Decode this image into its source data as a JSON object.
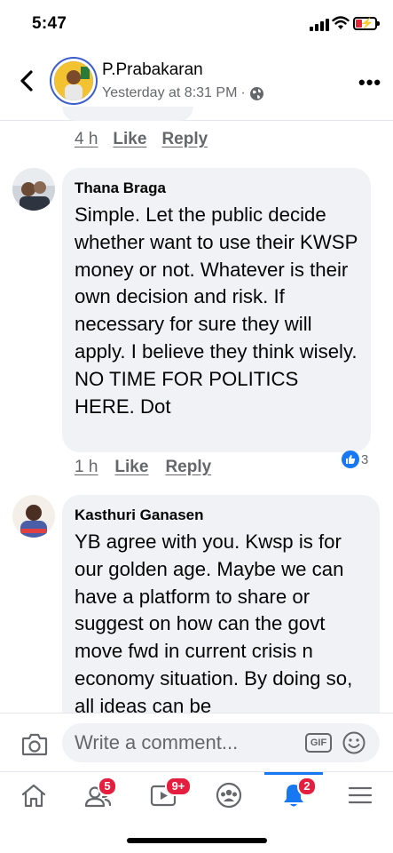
{
  "status_bar": {
    "time": "5:47"
  },
  "header": {
    "name": "P.Prabakaran",
    "timestamp": "Yesterday at 8:31 PM",
    "separator": "·"
  },
  "previous_comment": {
    "time": "4 h",
    "like_label": "Like",
    "reply_label": "Reply"
  },
  "comments": [
    {
      "author": "Thana Braga",
      "text": "Simple. Let the public decide whether want to use their KWSP money or not. Whatever is their own decision and risk. If necessary for sure they will apply. I believe they think wisely. NO TIME FOR POLITICS HERE. Dot",
      "time": "1 h",
      "like_label": "Like",
      "reply_label": "Reply",
      "reaction_count": "3"
    },
    {
      "author": "Kasthuri Ganasen",
      "text": "YB agree with you. Kwsp is for our golden age. Maybe we can have a platform to share or suggest on how can the govt move fwd in current crisis n economy situation. By doing so, all ideas can be"
    }
  ],
  "composer": {
    "placeholder": "Write a comment...",
    "gif_label": "GIF"
  },
  "nav": {
    "friends_badge": "5",
    "watch_badge": "9+",
    "notifications_badge": "2"
  },
  "colors": {
    "accent": "#1877f2",
    "badge": "#e41e3f",
    "bubble": "#f0f2f5",
    "secondary_text": "#65676b"
  }
}
